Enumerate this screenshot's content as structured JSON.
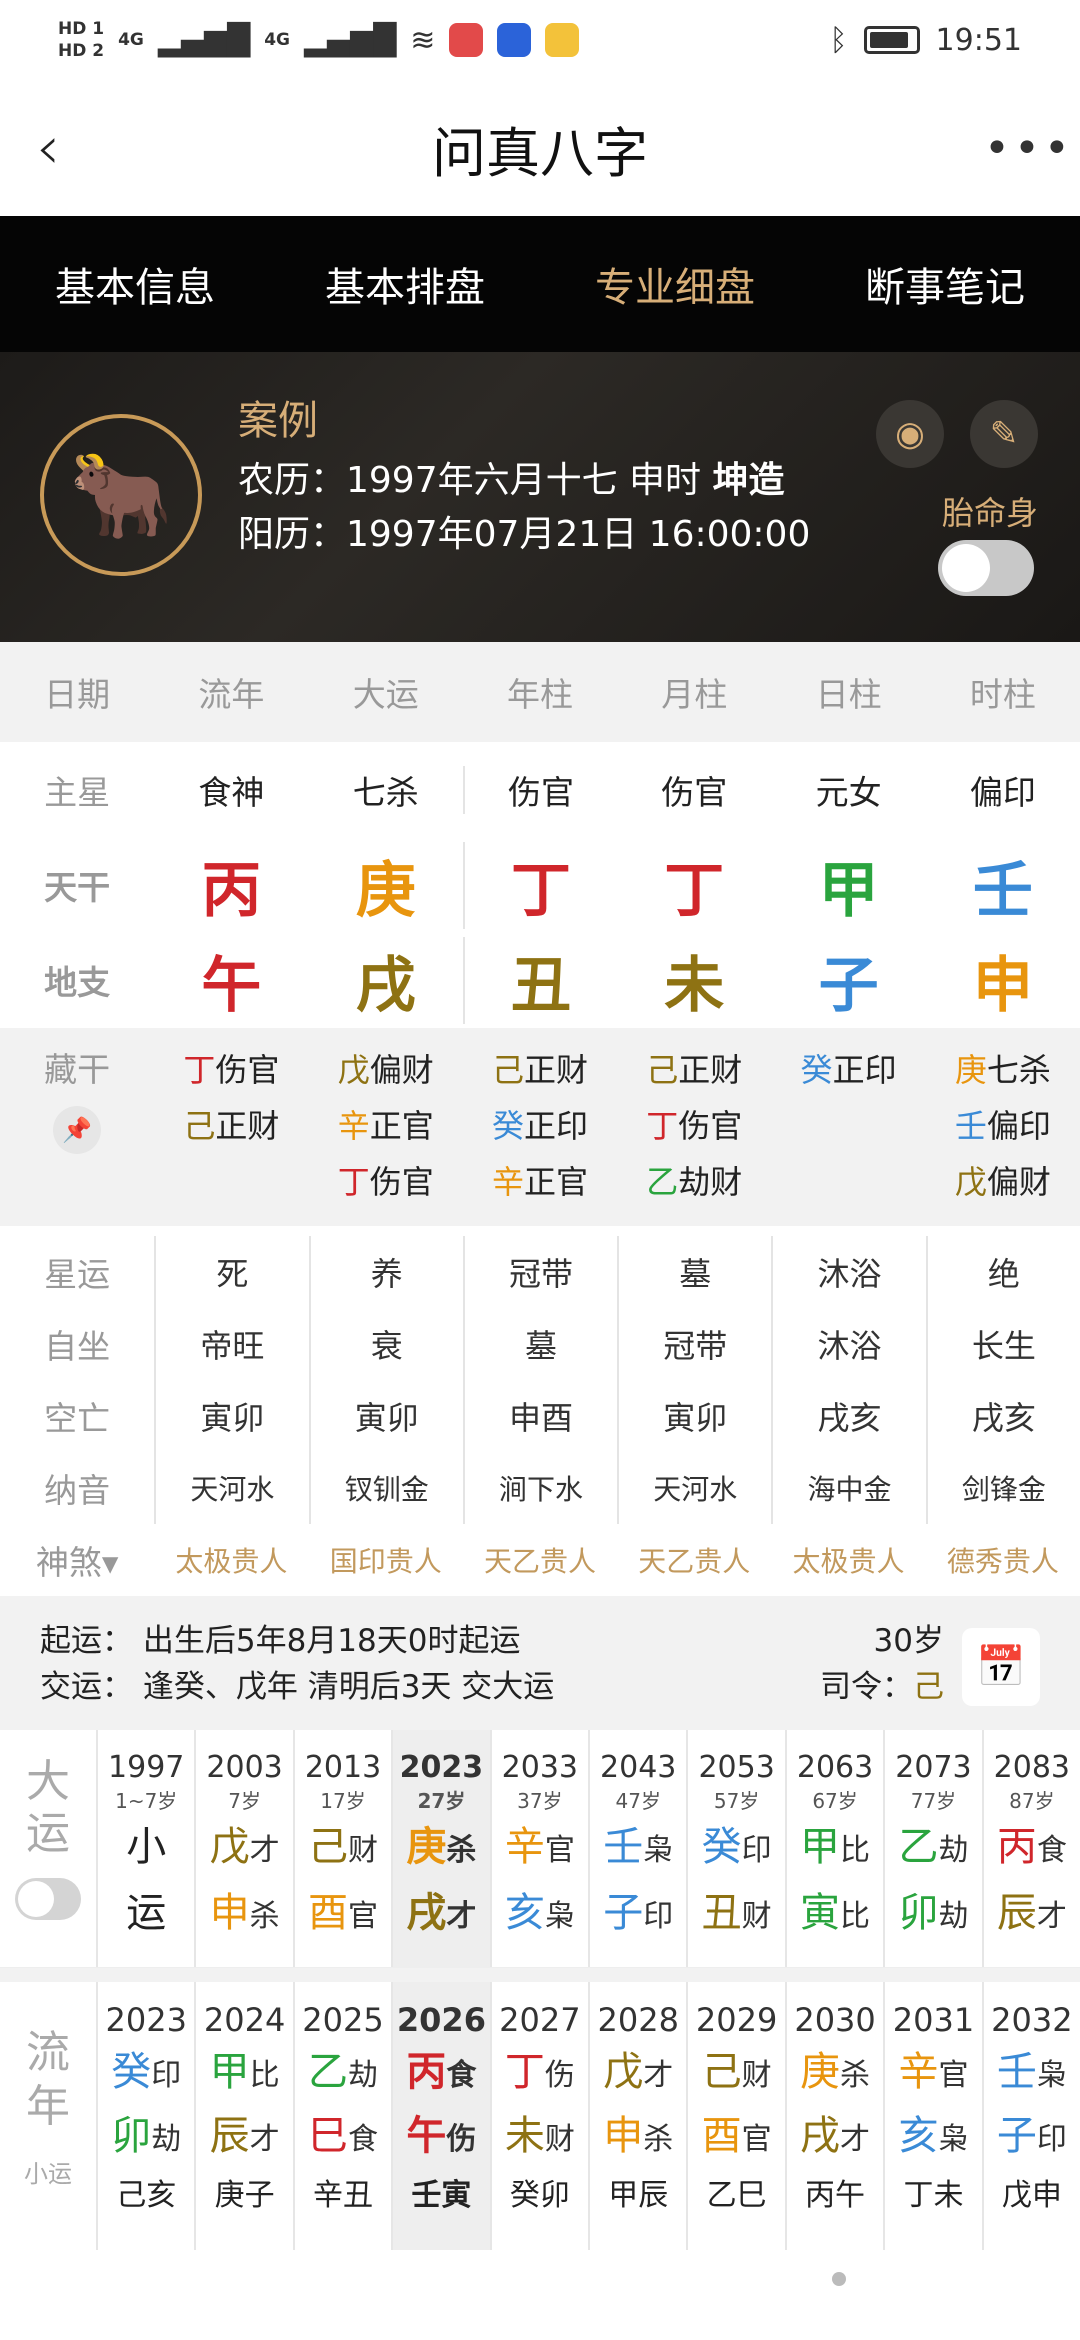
{
  "status": {
    "time": "19:51",
    "hd1": "HD 1",
    "hd2": "HD 2",
    "net": "4G"
  },
  "title": "问真八字",
  "tabs": [
    "基本信息",
    "基本排盘",
    "专业细盘",
    "断事笔记"
  ],
  "header": {
    "case": "案例",
    "lunar": "农历：1997年六月十七 申时 ",
    "gender": "坤造",
    "solar": "阳历：1997年07月21日 16:00:00",
    "taiming": "胎命身",
    "avatar_icon": "ox-zodiac-icon"
  },
  "columns": [
    "日期",
    "流年",
    "大运",
    "年柱",
    "月柱",
    "日柱",
    "时柱"
  ],
  "zhuxing": {
    "label": "主星",
    "values": [
      "食神",
      "七杀",
      "伤官",
      "伤官",
      "元女",
      "偏印"
    ]
  },
  "tiangan": {
    "label": "天干",
    "values": [
      {
        "t": "丙",
        "c": "#d0262b"
      },
      {
        "t": "庚",
        "c": "#e8950e"
      },
      {
        "t": "丁",
        "c": "#d0262b"
      },
      {
        "t": "丁",
        "c": "#d0262b"
      },
      {
        "t": "甲",
        "c": "#2aa43e"
      },
      {
        "t": "壬",
        "c": "#3a8ad6"
      }
    ]
  },
  "dizhi": {
    "label": "地支",
    "values": [
      {
        "t": "午",
        "c": "#d0262b"
      },
      {
        "t": "戌",
        "c": "#8e7213"
      },
      {
        "t": "丑",
        "c": "#8e7213"
      },
      {
        "t": "未",
        "c": "#8e7213"
      },
      {
        "t": "子",
        "c": "#3a8ad6"
      },
      {
        "t": "申",
        "c": "#e8950e"
      }
    ]
  },
  "canggan": {
    "label": "藏干",
    "cols": [
      [
        {
          "g": "丁",
          "c": "#d0262b",
          "s": "伤官"
        },
        {
          "g": "己",
          "c": "#8e7213",
          "s": "正财"
        }
      ],
      [
        {
          "g": "戊",
          "c": "#8e7213",
          "s": "偏财"
        },
        {
          "g": "辛",
          "c": "#e8950e",
          "s": "正官"
        },
        {
          "g": "丁",
          "c": "#d0262b",
          "s": "伤官"
        }
      ],
      [
        {
          "g": "己",
          "c": "#8e7213",
          "s": "正财"
        },
        {
          "g": "癸",
          "c": "#3a8ad6",
          "s": "正印"
        },
        {
          "g": "辛",
          "c": "#e8950e",
          "s": "正官"
        }
      ],
      [
        {
          "g": "己",
          "c": "#8e7213",
          "s": "正财"
        },
        {
          "g": "丁",
          "c": "#d0262b",
          "s": "伤官"
        },
        {
          "g": "乙",
          "c": "#2aa43e",
          "s": "劫财"
        }
      ],
      [
        {
          "g": "癸",
          "c": "#3a8ad6",
          "s": "正印"
        }
      ],
      [
        {
          "g": "庚",
          "c": "#e8950e",
          "s": "七杀"
        },
        {
          "g": "壬",
          "c": "#3a8ad6",
          "s": "偏印"
        },
        {
          "g": "戊",
          "c": "#8e7213",
          "s": "偏财"
        }
      ]
    ]
  },
  "xingyun": {
    "label": "星运",
    "values": [
      "死",
      "养",
      "冠带",
      "墓",
      "沐浴",
      "绝"
    ]
  },
  "zizuo": {
    "label": "自坐",
    "values": [
      "帝旺",
      "衰",
      "墓",
      "冠带",
      "沐浴",
      "长生"
    ]
  },
  "kongwang": {
    "label": "空亡",
    "values": [
      "寅卯",
      "寅卯",
      "申酉",
      "寅卯",
      "戌亥",
      "戌亥"
    ]
  },
  "nayin": {
    "label": "纳音",
    "values": [
      "天河水",
      "钗钏金",
      "涧下水",
      "天河水",
      "海中金",
      "剑锋金"
    ]
  },
  "shensha": {
    "label": "神煞▾",
    "values": [
      "太极贵人",
      "国印贵人",
      "天乙贵人",
      "天乙贵人",
      "太极贵人",
      "德秀贵人"
    ]
  },
  "qiyun": {
    "line1": "起运：  出生后5年8月18天0时起运",
    "line2": "交运：  逢癸、戊年 清明后3天 交大运",
    "age": "30岁",
    "siling": "司令：",
    "siling_val": "己"
  },
  "dayun": {
    "label1": "大",
    "label2": "运",
    "cols": [
      {
        "year": "1997",
        "age": "1~7岁",
        "g": "小",
        "gc": "#222",
        "gs": "",
        "z": "运",
        "zc": "#222",
        "zs": ""
      },
      {
        "year": "2003",
        "age": "7岁",
        "g": "戊",
        "gc": "#8e7213",
        "gs": "才",
        "z": "申",
        "zc": "#e8950e",
        "zs": "杀"
      },
      {
        "year": "2013",
        "age": "17岁",
        "g": "己",
        "gc": "#8e7213",
        "gs": "财",
        "z": "酉",
        "zc": "#e8950e",
        "zs": "官"
      },
      {
        "year": "2023",
        "age": "27岁",
        "g": "庚",
        "gc": "#e8950e",
        "gs": "杀",
        "z": "戌",
        "zc": "#8e7213",
        "zs": "才",
        "cur": true
      },
      {
        "year": "2033",
        "age": "37岁",
        "g": "辛",
        "gc": "#e8950e",
        "gs": "官",
        "z": "亥",
        "zc": "#3a8ad6",
        "zs": "枭"
      },
      {
        "year": "2043",
        "age": "47岁",
        "g": "壬",
        "gc": "#3a8ad6",
        "gs": "枭",
        "z": "子",
        "zc": "#3a8ad6",
        "zs": "印"
      },
      {
        "year": "2053",
        "age": "57岁",
        "g": "癸",
        "gc": "#3a8ad6",
        "gs": "印",
        "z": "丑",
        "zc": "#8e7213",
        "zs": "财"
      },
      {
        "year": "2063",
        "age": "67岁",
        "g": "甲",
        "gc": "#2aa43e",
        "gs": "比",
        "z": "寅",
        "zc": "#2aa43e",
        "zs": "比"
      },
      {
        "year": "2073",
        "age": "77岁",
        "g": "乙",
        "gc": "#2aa43e",
        "gs": "劫",
        "z": "卯",
        "zc": "#2aa43e",
        "zs": "劫"
      },
      {
        "year": "2083",
        "age": "87岁",
        "g": "丙",
        "gc": "#d0262b",
        "gs": "食",
        "z": "辰",
        "zc": "#8e7213",
        "zs": "才"
      }
    ]
  },
  "liunian": {
    "label1": "流",
    "label2": "年",
    "small": "小运",
    "cols": [
      {
        "year": "2023",
        "g": "癸",
        "gc": "#3a8ad6",
        "gs": "印",
        "z": "卯",
        "zc": "#2aa43e",
        "zs": "劫",
        "xy": "己亥"
      },
      {
        "year": "2024",
        "g": "甲",
        "gc": "#2aa43e",
        "gs": "比",
        "z": "辰",
        "zc": "#8e7213",
        "zs": "才",
        "xy": "庚子"
      },
      {
        "year": "2025",
        "g": "乙",
        "gc": "#2aa43e",
        "gs": "劫",
        "z": "巳",
        "zc": "#d0262b",
        "zs": "食",
        "xy": "辛丑"
      },
      {
        "year": "2026",
        "g": "丙",
        "gc": "#d0262b",
        "gs": "食",
        "z": "午",
        "zc": "#d0262b",
        "zs": "伤",
        "xy": "壬寅",
        "cur": true
      },
      {
        "year": "2027",
        "g": "丁",
        "gc": "#d0262b",
        "gs": "伤",
        "z": "未",
        "zc": "#8e7213",
        "zs": "财",
        "xy": "癸卯"
      },
      {
        "year": "2028",
        "g": "戊",
        "gc": "#8e7213",
        "gs": "才",
        "z": "申",
        "zc": "#e8950e",
        "zs": "杀",
        "xy": "甲辰"
      },
      {
        "year": "2029",
        "g": "己",
        "gc": "#8e7213",
        "gs": "财",
        "z": "酉",
        "zc": "#e8950e",
        "zs": "官",
        "xy": "乙巳"
      },
      {
        "year": "2030",
        "g": "庚",
        "gc": "#e8950e",
        "gs": "杀",
        "z": "戌",
        "zc": "#8e7213",
        "zs": "才",
        "xy": "丙午"
      },
      {
        "year": "2031",
        "g": "辛",
        "gc": "#e8950e",
        "gs": "官",
        "z": "亥",
        "zc": "#3a8ad6",
        "zs": "枭",
        "xy": "丁未"
      },
      {
        "year": "2032",
        "g": "壬",
        "gc": "#3a8ad6",
        "gs": "枭",
        "z": "子",
        "zc": "#3a8ad6",
        "zs": "印",
        "xy": "戊申"
      }
    ]
  }
}
